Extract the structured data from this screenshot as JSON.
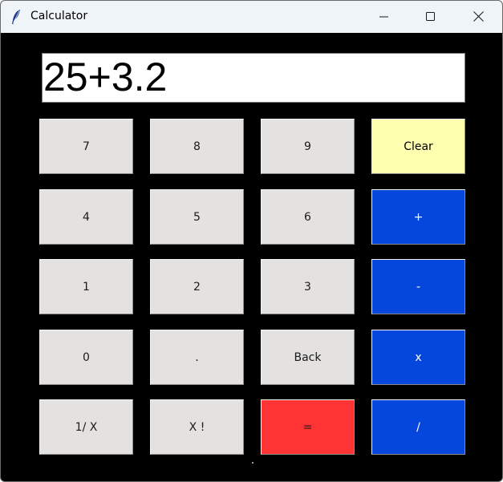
{
  "window": {
    "title": "Calculator"
  },
  "display": {
    "value": "25+3.2"
  },
  "buttons": {
    "seven": "7",
    "eight": "8",
    "nine": "9",
    "clear": "Clear",
    "four": "4",
    "five": "5",
    "six": "6",
    "plus": "+",
    "one": "1",
    "two": "2",
    "three": "3",
    "minus": "-",
    "zero": "0",
    "decimal": ".",
    "back": "Back",
    "multiply": "x",
    "reciprocal": "1/ X",
    "factorial": "X !",
    "equals": "=",
    "divide": "/"
  },
  "colors": {
    "background": "#000000",
    "digit_button": "#e4e2e0",
    "clear_button": "#ffffb0",
    "operator_button": "#0546dc",
    "equals_button": "#ff3434"
  },
  "icons": {
    "app": "feather-icon",
    "minimize": "minimize-icon",
    "maximize": "maximize-icon",
    "close": "close-icon"
  }
}
